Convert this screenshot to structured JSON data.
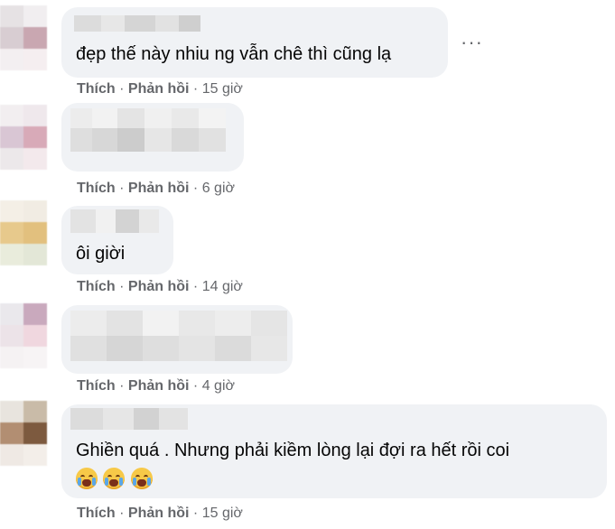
{
  "comments": [
    {
      "text": "đẹp thế này nhiu ng vẫn chê thì cũng lạ",
      "like": "Thích",
      "reply": "Phản hồi",
      "sep": "·",
      "time": "15 giờ"
    },
    {
      "text": "",
      "like": "Thích",
      "reply": "Phản hồi",
      "sep": "·",
      "time": "6 giờ"
    },
    {
      "text": "ôi giời",
      "like": "Thích",
      "reply": "Phản hồi",
      "sep": "·",
      "time": "14 giờ"
    },
    {
      "text": "",
      "like": "Thích",
      "reply": "Phản hồi",
      "sep": "·",
      "time": "4 giờ"
    },
    {
      "text": "Ghiền quá . Nhưng phải kiềm lòng lại đợi ra hết rồi coi",
      "like": "Thích",
      "reply": "Phản hồi",
      "sep": "·",
      "time": "15 giờ"
    }
  ],
  "more_options": "···",
  "icons": {
    "more": "more-options-icon",
    "emoji": "crying-face-emoji-icon"
  },
  "colors": {
    "bubble": "#f0f2f5",
    "text": "#050505",
    "meta": "#65676b"
  }
}
